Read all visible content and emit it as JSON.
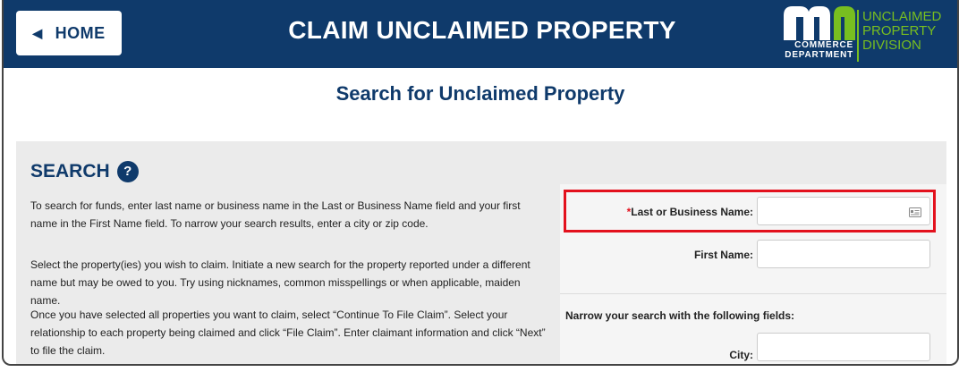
{
  "header": {
    "home_label": "HOME",
    "title": "CLAIM UNCLAIMED PROPERTY",
    "logo_text": "mn",
    "logo_dept_line1": "COMMERCE",
    "logo_dept_line2": "DEPARTMENT",
    "logo_div_line1": "UNCLAIMED",
    "logo_div_line2": "PROPERTY",
    "logo_div_line3": "DIVISION"
  },
  "page_title": "Search for Unclaimed Property",
  "search": {
    "heading": "SEARCH",
    "help_glyph": "?",
    "instructions": [
      "To search for funds, enter last name or business name in the Last or Business Name field and your first name in the First Name field. To narrow your search results, enter a city or zip code.",
      "Select the property(ies) you wish to claim. Initiate a new search for the property reported under a different name but may be owed to you. Try using nicknames, common misspellings or when applicable, maiden name.",
      "Once you have selected all properties you want to claim, select “Continue To File Claim”. Select your relationship to each property being claimed and click “File Claim”. Enter claimant information and click “Next” to file the claim."
    ]
  },
  "form": {
    "required_mark": "*",
    "last_name_label": "Last or Business Name:",
    "last_name_value": "",
    "first_name_label": "First Name:",
    "first_name_value": "",
    "narrow_label": "Narrow your search with the following fields:",
    "city_label": "City:",
    "city_value": ""
  },
  "colors": {
    "brand_navy": "#0f3a6b",
    "brand_green": "#78be20",
    "highlight_red": "#e3111d"
  }
}
